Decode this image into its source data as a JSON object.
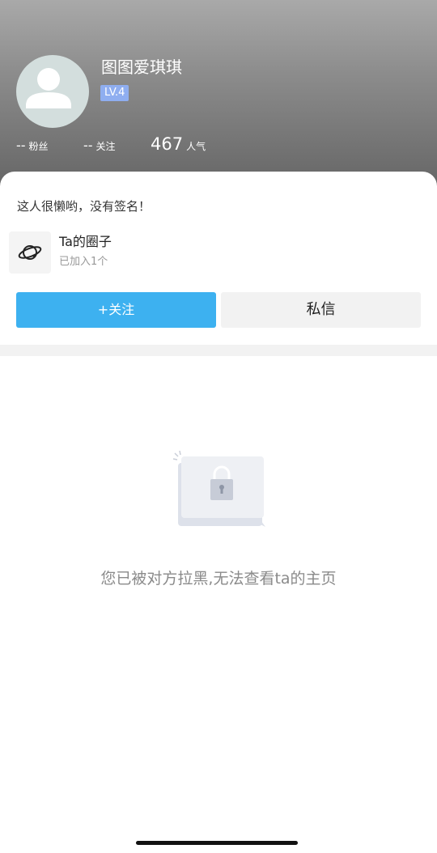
{
  "profile": {
    "username": "图图爱琪琪",
    "level": "LV.4",
    "stats": {
      "fans_value": "--",
      "fans_label": "粉丝",
      "following_value": "--",
      "following_label": "关注",
      "popularity_value": "467",
      "popularity_label": "人气"
    },
    "bio": "这人很懒哟，没有签名！"
  },
  "circle": {
    "icon": "planet-icon",
    "title": "Ta的圈子",
    "subtitle": "已加入1个"
  },
  "actions": {
    "follow_label": "+关注",
    "message_label": "私信"
  },
  "empty_state": {
    "icon": "lock-icon",
    "text": "您已被对方拉黑,无法查看ta的主页"
  },
  "colors": {
    "accent": "#3db1f0",
    "level_badge": "#8faef0"
  }
}
